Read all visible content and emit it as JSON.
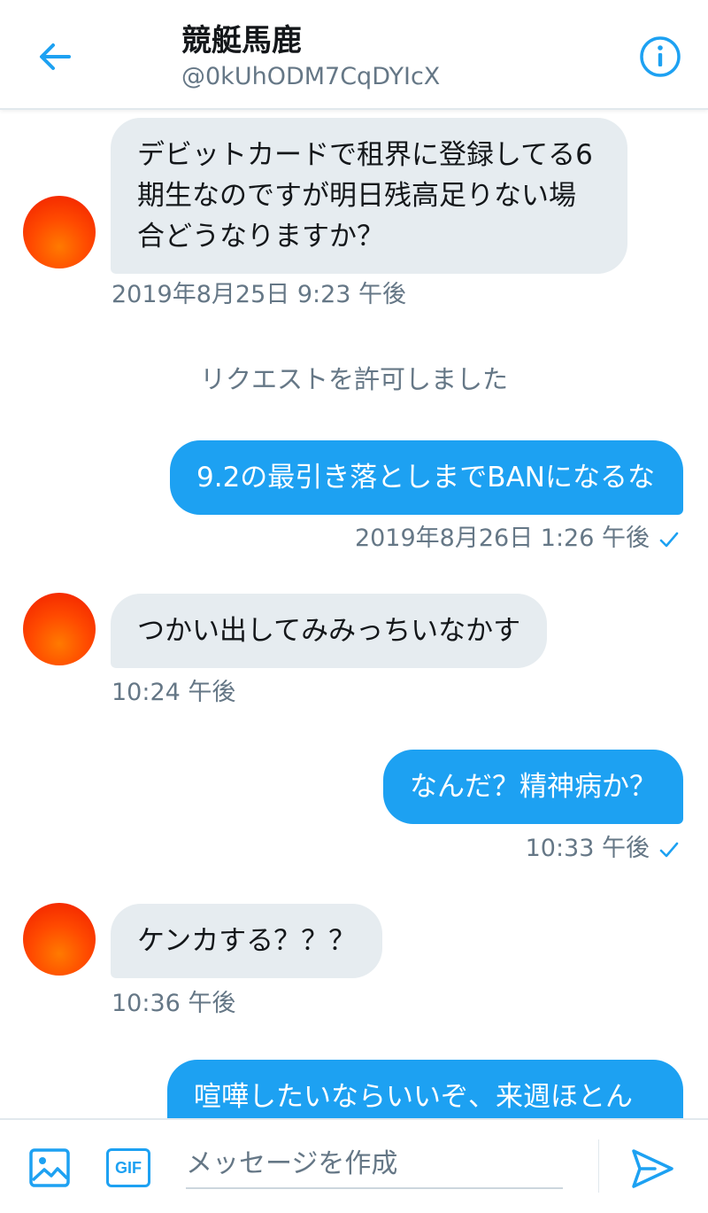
{
  "header": {
    "title": "競艇馬鹿",
    "handle": "@0kUhODM7CqDYIcX"
  },
  "messages": [
    {
      "direction": "in",
      "text": "デビットカードで租界に登録してる6期生なのですが明日残高足りない場合どうなりますか？",
      "timestamp": "2019年8月25日 9:23 午後"
    },
    {
      "direction": "system",
      "text": "リクエストを許可しました"
    },
    {
      "direction": "out",
      "text": "9.2の最引き落としまでBANになるな",
      "timestamp": "2019年8月26日 1:26 午後"
    },
    {
      "direction": "in",
      "text": "つかい出してみみっちいなかす",
      "timestamp": "10:24 午後"
    },
    {
      "direction": "out",
      "text": "なんだ？精神病か？",
      "timestamp": "10:33 午後"
    },
    {
      "direction": "in",
      "text": "ケンカする？？？",
      "timestamp": "10:36 午後"
    },
    {
      "direction": "out",
      "text": "喧嘩したいならいいぞ、来週ほとん"
    }
  ],
  "composer": {
    "gif_label": "GIF",
    "placeholder": "メッセージを作成"
  },
  "icons": {
    "back": "arrow-left-icon",
    "info": "info-icon",
    "media": "image-icon",
    "gif": "gif-icon",
    "send": "send-icon",
    "read": "check-icon"
  },
  "colors": {
    "accent": "#1da1f2",
    "incoming_bubble": "#e6ecf0",
    "muted_text": "#657786"
  }
}
